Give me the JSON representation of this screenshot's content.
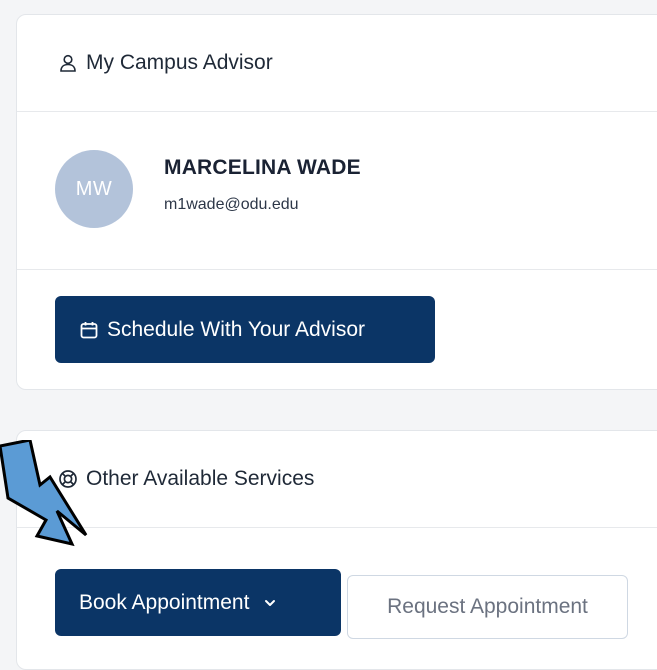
{
  "advisor_card": {
    "title": "My Campus Advisor",
    "title_icon": "user-icon",
    "advisor": {
      "initials": "MW",
      "name": "MARCELINA WADE",
      "email": "m1wade@odu.edu"
    },
    "schedule_button": {
      "label": "Schedule With Your Advisor",
      "icon": "calendar-icon"
    }
  },
  "services_card": {
    "title": "Other Available Services",
    "title_icon": "lifebuoy-icon",
    "book_button": {
      "label": "Book Appointment",
      "icon": "chevron-down-icon"
    },
    "request_button": {
      "label": "Request Appointment"
    }
  },
  "annotation": {
    "icon": "pointer-arrow-icon",
    "color": "#5b9bd5"
  },
  "colors": {
    "primary": "#0b3566",
    "avatar_bg": "#b3c3da",
    "page_bg": "#f4f5f7"
  }
}
